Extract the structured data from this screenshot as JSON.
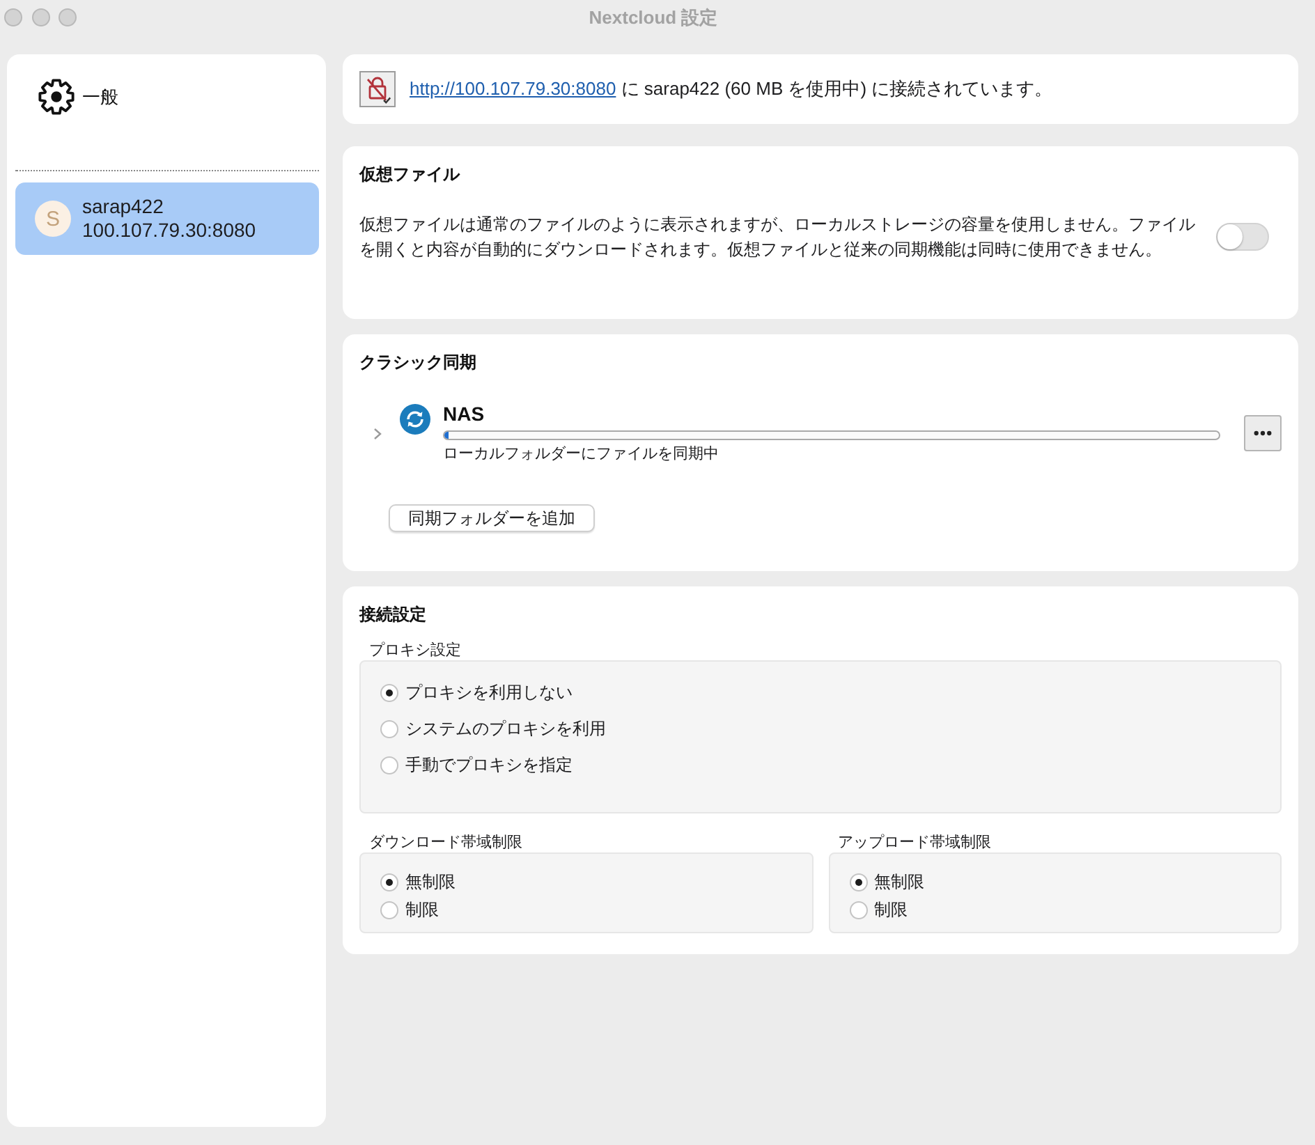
{
  "window": {
    "title": "Nextcloud 設定"
  },
  "sidebar": {
    "items": [
      {
        "kind": "general",
        "label": "一般",
        "selected": false
      },
      {
        "kind": "account",
        "avatar": "S",
        "name": "sarap422",
        "server": "100.107.79.30:8080",
        "selected": true
      }
    ]
  },
  "connection_status": {
    "link": "http://100.107.79.30:8080",
    "text": "に sarap422 (60 MB を使用中) に接続されています。"
  },
  "virtual_files": {
    "title": "仮想ファイル",
    "description": "仮想ファイルは通常のファイルのように表示されますが、ローカルストレージの容量を使用しません。ファイルを開くと内容が自動的にダウンロードされます。仮想ファイルと従来の同期機能は同時に使用できません。",
    "on": false
  },
  "classic_sync": {
    "title": "クラシック同期",
    "folders": [
      {
        "name": "NAS",
        "expanded": false,
        "level": 0.005,
        "status": "ローカルフォルダーにファイルを同期中"
      }
    ],
    "add_button": "同期フォルダーを追加"
  },
  "connection_settings": {
    "title": "接続設定",
    "proxy": {
      "label": "プロキシ設定",
      "options": [
        {
          "label": "プロキシを利用しない",
          "selected": true
        },
        {
          "label": "システムのプロキシを利用",
          "selected": false
        },
        {
          "label": "手動でプロキシを指定",
          "selected": false
        }
      ]
    },
    "bandwidth": [
      {
        "label": "ダウンロード帯域制限",
        "options": [
          {
            "label": "無制限",
            "selected": true
          },
          {
            "label": "制限",
            "selected": false
          }
        ]
      },
      {
        "label": "アップロード帯域制限",
        "options": [
          {
            "label": "無制限",
            "selected": true
          },
          {
            "label": "制限",
            "selected": false
          }
        ]
      }
    ]
  }
}
